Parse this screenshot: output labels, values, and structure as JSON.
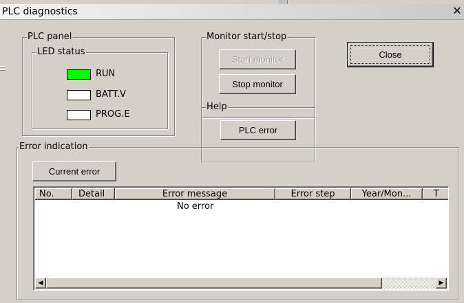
{
  "window": {
    "title": "PLC diagnostics",
    "close_glyph": "✕"
  },
  "plc_panel": {
    "label": "PLC panel",
    "led_status": {
      "label": "LED status",
      "leds": [
        {
          "label": "RUN",
          "state": "on",
          "color": "#00ff00"
        },
        {
          "label": "BATT.V",
          "state": "off",
          "color": "#ffffff"
        },
        {
          "label": "PROG.E",
          "state": "off",
          "color": "#ffffff"
        }
      ]
    }
  },
  "monitor": {
    "label": "Monitor start/stop",
    "start_label": "Start monitor",
    "start_enabled": false,
    "stop_label": "Stop monitor"
  },
  "help": {
    "label": "Help",
    "plc_error_label": "PLC error"
  },
  "close_label": "Close",
  "error_indication": {
    "label": "Error indication",
    "current_error_label": "Current error",
    "columns": [
      "No.",
      "Detail",
      "Error message",
      "Error step",
      "Year/Mon...",
      "T"
    ],
    "rows": [
      {
        "message": "No error"
      }
    ],
    "scroll_left_icon": "scroll-left-arrow",
    "scroll_right_icon": "scroll-right-arrow"
  }
}
